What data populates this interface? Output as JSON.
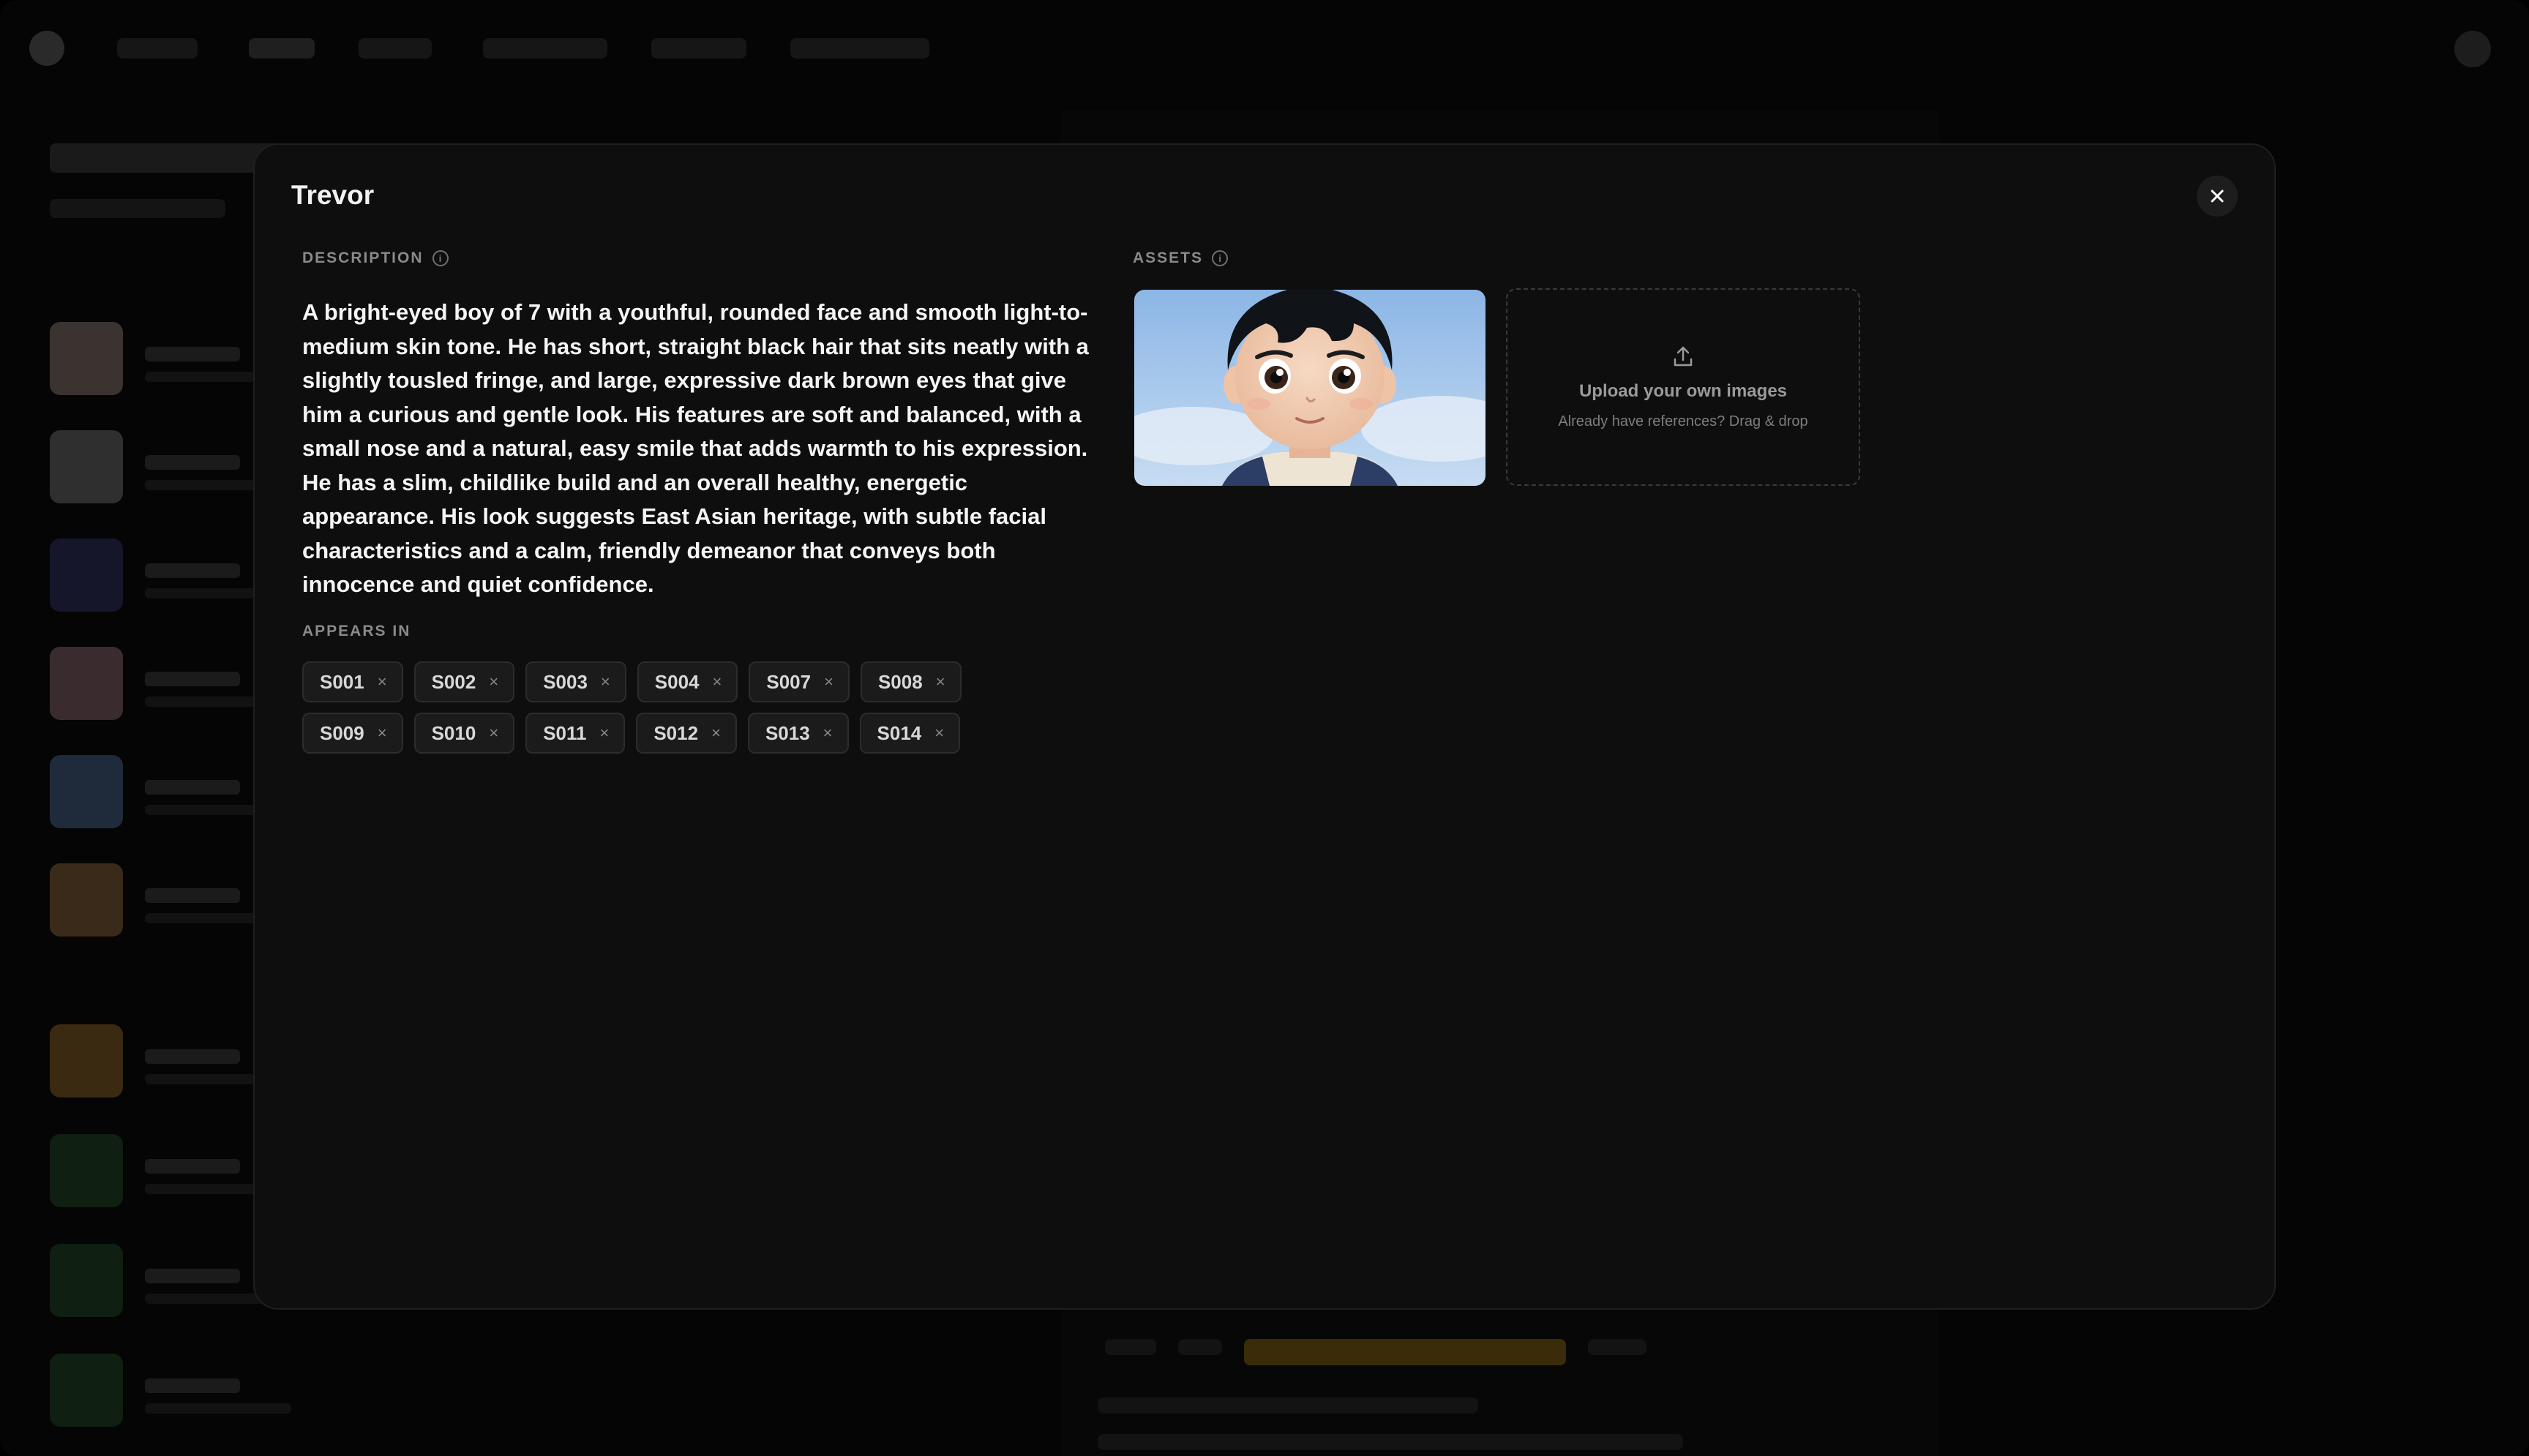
{
  "modal": {
    "title": "Trevor",
    "description_label": "DESCRIPTION",
    "description": "A bright-eyed boy of 7 with a youthful, rounded face and smooth light-to-medium skin tone. He has short, straight black hair that sits neatly with a slightly tousled fringe, and large, expressive dark brown eyes that give him a curious and gentle look. His features are soft and balanced, with a small nose and a natural, easy smile that adds warmth to his expression. He has a slim, childlike build and an overall healthy, energetic appearance. His look suggests East Asian heritage, with subtle facial characteristics and a calm, friendly demeanor that conveys both innocence and quiet confidence.",
    "appears_in_label": "APPEARS IN",
    "scenes_row1": [
      "S001",
      "S002",
      "S003",
      "S004",
      "S007",
      "S008"
    ],
    "scenes_row2": [
      "S009",
      "S010",
      "S011",
      "S012",
      "S013",
      "S014"
    ],
    "remove_glyph": "×",
    "assets_label": "ASSETS",
    "upload": {
      "title": "Upload your own images",
      "subtitle": "Already have references? Drag & drop"
    },
    "close_icon": "close-icon",
    "info_icon": "info-icon",
    "info_glyph": "i"
  },
  "colors": {
    "modal_bg": "#0e0e0e",
    "tag_bg": "#1b1b1b",
    "text_primary": "#f5f5f5",
    "label": "#8a8a8a"
  }
}
